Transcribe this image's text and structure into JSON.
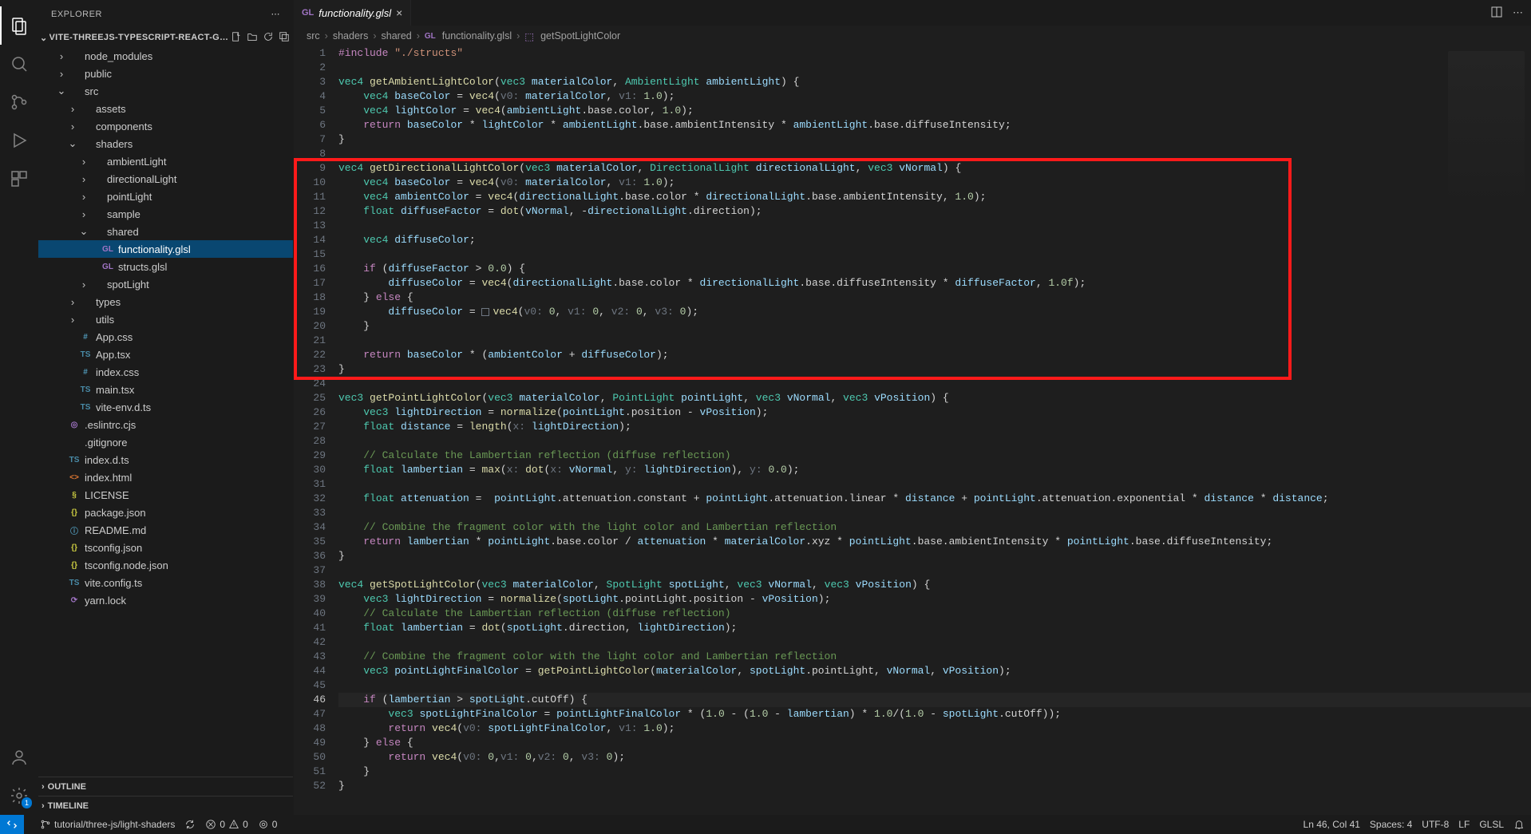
{
  "sidebar": {
    "title": "EXPLORER",
    "root": "VITE-THREEJS-TYPESCRIPT-REACT-GLSL-STARTER-...",
    "sections": {
      "outline": "OUTLINE",
      "timeline": "TIMELINE"
    },
    "tree": [
      {
        "depth": 1,
        "kind": "folder",
        "open": false,
        "label": "node_modules"
      },
      {
        "depth": 1,
        "kind": "folder",
        "open": false,
        "label": "public"
      },
      {
        "depth": 1,
        "kind": "folder",
        "open": true,
        "label": "src"
      },
      {
        "depth": 2,
        "kind": "folder",
        "open": false,
        "label": "assets"
      },
      {
        "depth": 2,
        "kind": "folder",
        "open": false,
        "label": "components"
      },
      {
        "depth": 2,
        "kind": "folder",
        "open": true,
        "label": "shaders"
      },
      {
        "depth": 3,
        "kind": "folder",
        "open": false,
        "label": "ambientLight"
      },
      {
        "depth": 3,
        "kind": "folder",
        "open": false,
        "label": "directionalLight"
      },
      {
        "depth": 3,
        "kind": "folder",
        "open": false,
        "label": "pointLight"
      },
      {
        "depth": 3,
        "kind": "folder",
        "open": false,
        "label": "sample"
      },
      {
        "depth": 3,
        "kind": "folder",
        "open": true,
        "label": "shared"
      },
      {
        "depth": 4,
        "kind": "file",
        "icon": "GL",
        "iconColor": "#a074c4",
        "label": "functionality.glsl",
        "selected": true
      },
      {
        "depth": 4,
        "kind": "file",
        "icon": "GL",
        "iconColor": "#a074c4",
        "label": "structs.glsl"
      },
      {
        "depth": 3,
        "kind": "folder",
        "open": false,
        "label": "spotLight"
      },
      {
        "depth": 2,
        "kind": "folder",
        "open": false,
        "label": "types"
      },
      {
        "depth": 2,
        "kind": "folder",
        "open": false,
        "label": "utils"
      },
      {
        "depth": 2,
        "kind": "file",
        "icon": "#",
        "iconColor": "#519aba",
        "label": "App.css"
      },
      {
        "depth": 2,
        "kind": "file",
        "icon": "TS",
        "iconColor": "#498ba7",
        "label": "App.tsx"
      },
      {
        "depth": 2,
        "kind": "file",
        "icon": "#",
        "iconColor": "#519aba",
        "label": "index.css"
      },
      {
        "depth": 2,
        "kind": "file",
        "icon": "TS",
        "iconColor": "#498ba7",
        "label": "main.tsx"
      },
      {
        "depth": 2,
        "kind": "file",
        "icon": "TS",
        "iconColor": "#498ba7",
        "label": "vite-env.d.ts"
      },
      {
        "depth": 1,
        "kind": "file",
        "icon": "◎",
        "iconColor": "#a074c4",
        "label": ".eslintrc.cjs"
      },
      {
        "depth": 1,
        "kind": "file",
        "icon": "",
        "iconColor": "#6d8086",
        "label": ".gitignore"
      },
      {
        "depth": 1,
        "kind": "file",
        "icon": "TS",
        "iconColor": "#498ba7",
        "label": "index.d.ts"
      },
      {
        "depth": 1,
        "kind": "file",
        "icon": "<>",
        "iconColor": "#e37933",
        "label": "index.html"
      },
      {
        "depth": 1,
        "kind": "file",
        "icon": "§",
        "iconColor": "#cbcb41",
        "label": "LICENSE"
      },
      {
        "depth": 1,
        "kind": "file",
        "icon": "{}",
        "iconColor": "#cbcb41",
        "label": "package.json"
      },
      {
        "depth": 1,
        "kind": "file",
        "icon": "ⓘ",
        "iconColor": "#519aba",
        "label": "README.md"
      },
      {
        "depth": 1,
        "kind": "file",
        "icon": "{}",
        "iconColor": "#cbcb41",
        "label": "tsconfig.json"
      },
      {
        "depth": 1,
        "kind": "file",
        "icon": "{}",
        "iconColor": "#cbcb41",
        "label": "tsconfig.node.json"
      },
      {
        "depth": 1,
        "kind": "file",
        "icon": "TS",
        "iconColor": "#498ba7",
        "label": "vite.config.ts"
      },
      {
        "depth": 1,
        "kind": "file",
        "icon": "⟳",
        "iconColor": "#a074c4",
        "label": "yarn.lock"
      }
    ]
  },
  "tab": {
    "icon": "GL",
    "name": "functionality.glsl"
  },
  "breadcrumbs": {
    "parts": [
      "src",
      "shaders",
      "shared"
    ],
    "file": "functionality.glsl",
    "symbol": "getSpotLightColor"
  },
  "editor": {
    "currentLine": 46,
    "highlight": {
      "startLine": 9,
      "endLine": 23
    },
    "lines": [
      {
        "n": 1,
        "html": "<span class='dir'>#include</span> <span class='str'>\"./structs\"</span>"
      },
      {
        "n": 2,
        "html": ""
      },
      {
        "n": 3,
        "html": "<span class='kw'>vec4</span> <span class='fn'>getAmbientLightColor</span>(<span class='kw'>vec3</span> <span class='par'>materialColor</span>, <span class='typ'>AmbientLight</span> <span class='par'>ambientLight</span>) {"
      },
      {
        "n": 4,
        "html": "    <span class='kw'>vec4</span> <span class='par'>baseColor</span> = <span class='fn'>vec4</span>(<span class='hint'>v0:</span> <span class='par'>materialColor</span>, <span class='hint'>v1:</span> <span class='num'>1.0</span>);"
      },
      {
        "n": 5,
        "html": "    <span class='kw'>vec4</span> <span class='par'>lightColor</span> = <span class='fn'>vec4</span>(<span class='par'>ambientLight</span>.base.color, <span class='num'>1.0</span>);"
      },
      {
        "n": 6,
        "html": "    <span class='kw2'>return</span> <span class='par'>baseColor</span> * <span class='par'>lightColor</span> * <span class='par'>ambientLight</span>.base.ambientIntensity * <span class='par'>ambientLight</span>.base.diffuseIntensity;"
      },
      {
        "n": 7,
        "html": "}"
      },
      {
        "n": 8,
        "html": ""
      },
      {
        "n": 9,
        "html": "<span class='kw'>vec4</span> <span class='fn'>getDirectionalLightColor</span>(<span class='kw'>vec3</span> <span class='par'>materialColor</span>, <span class='typ'>DirectionalLight</span> <span class='par'>directionalLight</span>, <span class='kw'>vec3</span> <span class='par'>vNormal</span>) {"
      },
      {
        "n": 10,
        "html": "    <span class='kw'>vec4</span> <span class='par'>baseColor</span> = <span class='fn'>vec4</span>(<span class='hint'>v0:</span> <span class='par'>materialColor</span>, <span class='hint'>v1:</span> <span class='num'>1.0</span>);"
      },
      {
        "n": 11,
        "html": "    <span class='kw'>vec4</span> <span class='par'>ambientColor</span> = <span class='fn'>vec4</span>(<span class='par'>directionalLight</span>.base.color * <span class='par'>directionalLight</span>.base.ambientIntensity, <span class='num'>1.0</span>);"
      },
      {
        "n": 12,
        "html": "    <span class='kw'>float</span> <span class='par'>diffuseFactor</span> = <span class='fn'>dot</span>(<span class='par'>vNormal</span>, -<span class='par'>directionalLight</span>.direction);"
      },
      {
        "n": 13,
        "html": ""
      },
      {
        "n": 14,
        "html": "    <span class='kw'>vec4</span> <span class='par'>diffuseColor</span>;"
      },
      {
        "n": 15,
        "html": ""
      },
      {
        "n": 16,
        "html": "    <span class='kw2'>if</span> (<span class='par'>diffuseFactor</span> &gt; <span class='num'>0.0</span>) {"
      },
      {
        "n": 17,
        "html": "        <span class='par'>diffuseColor</span> = <span class='fn'>vec4</span>(<span class='par'>directionalLight</span>.base.color * <span class='par'>directionalLight</span>.base.diffuseIntensity * <span class='par'>diffuseFactor</span>, <span class='num'>1.0f</span>);"
      },
      {
        "n": 18,
        "html": "    } <span class='kw2'>else</span> {"
      },
      {
        "n": 19,
        "html": "        <span class='par'>diffuseColor</span> = <span class='hib'></span><span class='fn'>vec4</span>(<span class='hint'>v0:</span> <span class='num'>0</span>, <span class='hint'>v1:</span> <span class='num'>0</span>, <span class='hint'>v2:</span> <span class='num'>0</span>, <span class='hint'>v3:</span> <span class='num'>0</span>);"
      },
      {
        "n": 20,
        "html": "    }"
      },
      {
        "n": 21,
        "html": ""
      },
      {
        "n": 22,
        "html": "    <span class='kw2'>return</span> <span class='par'>baseColor</span> * (<span class='par'>ambientColor</span> + <span class='par'>diffuseColor</span>);"
      },
      {
        "n": 23,
        "html": "}"
      },
      {
        "n": 24,
        "html": ""
      },
      {
        "n": 25,
        "html": "<span class='kw'>vec3</span> <span class='fn'>getPointLightColor</span>(<span class='kw'>vec3</span> <span class='par'>materialColor</span>, <span class='typ'>PointLight</span> <span class='par'>pointLight</span>, <span class='kw'>vec3</span> <span class='par'>vNormal</span>, <span class='kw'>vec3</span> <span class='par'>vPosition</span>) {"
      },
      {
        "n": 26,
        "html": "    <span class='kw'>vec3</span> <span class='par'>lightDirection</span> = <span class='fn'>normalize</span>(<span class='par'>pointLight</span>.position - <span class='par'>vPosition</span>);"
      },
      {
        "n": 27,
        "html": "    <span class='kw'>float</span> <span class='par'>distance</span> = <span class='fn'>length</span>(<span class='hint'>x:</span> <span class='par'>lightDirection</span>);"
      },
      {
        "n": 28,
        "html": ""
      },
      {
        "n": 29,
        "html": "    <span class='cmt'>// Calculate the Lambertian reflection (diffuse reflection)</span>"
      },
      {
        "n": 30,
        "html": "    <span class='kw'>float</span> <span class='par'>lambertian</span> = <span class='fn'>max</span>(<span class='hint'>x:</span> <span class='fn'>dot</span>(<span class='hint'>x:</span> <span class='par'>vNormal</span>, <span class='hint'>y:</span> <span class='par'>lightDirection</span>), <span class='hint'>y:</span> <span class='num'>0.0</span>);"
      },
      {
        "n": 31,
        "html": ""
      },
      {
        "n": 32,
        "html": "    <span class='kw'>float</span> <span class='par'>attenuation</span> =  <span class='par'>pointLight</span>.attenuation.constant + <span class='par'>pointLight</span>.attenuation.linear * <span class='par'>distance</span> + <span class='par'>pointLight</span>.attenuation.exponential * <span class='par'>distance</span> * <span class='par'>distance</span>;"
      },
      {
        "n": 33,
        "html": ""
      },
      {
        "n": 34,
        "html": "    <span class='cmt'>// Combine the fragment color with the light color and Lambertian reflection</span>"
      },
      {
        "n": 35,
        "html": "    <span class='kw2'>return</span> <span class='par'>lambertian</span> * <span class='par'>pointLight</span>.base.color / <span class='par'>attenuation</span> * <span class='par'>materialColor</span>.xyz * <span class='par'>pointLight</span>.base.ambientIntensity * <span class='par'>pointLight</span>.base.diffuseIntensity;"
      },
      {
        "n": 36,
        "html": "}"
      },
      {
        "n": 37,
        "html": ""
      },
      {
        "n": 38,
        "html": "<span class='kw'>vec4</span> <span class='fn'>getSpotLightColor</span>(<span class='kw'>vec3</span> <span class='par'>materialColor</span>, <span class='typ'>SpotLight</span> <span class='par'>spotLight</span>, <span class='kw'>vec3</span> <span class='par'>vNormal</span>, <span class='kw'>vec3</span> <span class='par'>vPosition</span>) {"
      },
      {
        "n": 39,
        "html": "    <span class='kw'>vec3</span> <span class='par'>lightDirection</span> = <span class='fn'>normalize</span>(<span class='par'>spotLight</span>.pointLight.position - <span class='par'>vPosition</span>);"
      },
      {
        "n": 40,
        "html": "    <span class='cmt'>// Calculate the Lambertian reflection (diffuse reflection)</span>"
      },
      {
        "n": 41,
        "html": "    <span class='kw'>float</span> <span class='par'>lambertian</span> = <span class='fn'>dot</span>(<span class='par'>spotLight</span>.direction, <span class='par'>lightDirection</span>);"
      },
      {
        "n": 42,
        "html": ""
      },
      {
        "n": 43,
        "html": "    <span class='cmt'>// Combine the fragment color with the light color and Lambertian reflection</span>"
      },
      {
        "n": 44,
        "html": "    <span class='kw'>vec3</span> <span class='par'>pointLightFinalColor</span> = <span class='fn'>getPointLightColor</span>(<span class='par'>materialColor</span>, <span class='par'>spotLight</span>.pointLight, <span class='par'>vNormal</span>, <span class='par'>vPosition</span>);"
      },
      {
        "n": 45,
        "html": ""
      },
      {
        "n": 46,
        "html": "    <span class='kw2'>if</span> (<span class='par'>lambertian</span> &gt; <span class='par'>spotLight</span>.cutOff) {"
      },
      {
        "n": 47,
        "html": "        <span class='kw'>vec3</span> <span class='par'>spotLightFinalColor</span> = <span class='par'>pointLightFinalColor</span> * (<span class='num'>1.0</span> - (<span class='num'>1.0</span> - <span class='par'>lambertian</span>) * <span class='num'>1.0</span>/(<span class='num'>1.0</span> - <span class='par'>spotLight</span>.cutOff));"
      },
      {
        "n": 48,
        "html": "        <span class='kw2'>return</span> <span class='fn'>vec4</span>(<span class='hint'>v0:</span> <span class='par'>spotLightFinalColor</span>, <span class='hint'>v1:</span> <span class='num'>1.0</span>);"
      },
      {
        "n": 49,
        "html": "    } <span class='kw2'>else</span> {"
      },
      {
        "n": 50,
        "html": "        <span class='kw2'>return</span> <span class='fn'>vec4</span>(<span class='hint'>v0:</span> <span class='num'>0</span>,<span class='hint'>v1:</span> <span class='num'>0</span>,<span class='hint'>v2:</span> <span class='num'>0</span>, <span class='hint'>v3:</span> <span class='num'>0</span>);"
      },
      {
        "n": 51,
        "html": "    }"
      },
      {
        "n": 52,
        "html": "}"
      }
    ]
  },
  "statusbar": {
    "branch": "tutorial/three-js/light-shaders",
    "errors": "0",
    "warnings": "0",
    "ports": "0",
    "position": "Ln 46, Col 41",
    "spaces": "Spaces: 4",
    "encoding": "UTF-8",
    "eol": "LF",
    "lang": "GLSL"
  },
  "settings_badge": "1"
}
